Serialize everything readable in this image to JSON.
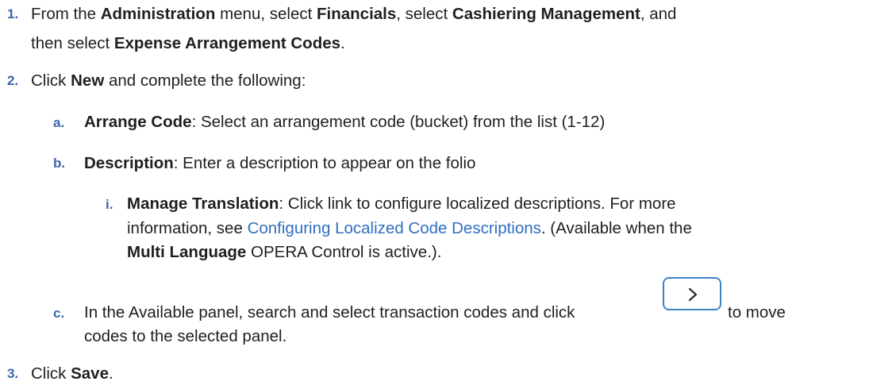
{
  "steps": [
    {
      "num": "1.",
      "line1": {
        "t1": "From the ",
        "b1": "Administration",
        "t2": " menu, select ",
        "b2": "Financials",
        "t3": ", select ",
        "b3": "Cashiering Management",
        "t4": ", and"
      },
      "line2": {
        "t1": "then select ",
        "b1": "Expense Arrangement Codes",
        "t2": "."
      }
    },
    {
      "num": "2.",
      "line1": {
        "t1": "Click ",
        "b1": "New",
        "t2": " and complete the following:"
      }
    },
    {
      "num": "3.",
      "line1": {
        "t1": "Click ",
        "b1": "Save",
        "t2": "."
      }
    }
  ],
  "substeps": [
    {
      "num": "a.",
      "b1": "Arrange Code",
      "t1": ": Select an arrangement code (bucket) from the list (1-12)"
    },
    {
      "num": "b.",
      "b1": "Description",
      "t1": ": Enter a description to appear on the folio"
    },
    {
      "num": "c.",
      "t1": "In the Available panel, search and select transaction codes and click",
      "t2": "to move",
      "line2": "codes to the selected panel."
    }
  ],
  "subsub": {
    "num": "i.",
    "line1": {
      "b1": "Manage Translation",
      "t1": ": Click link to configure localized descriptions. For more"
    },
    "line2": {
      "t1": "information, see ",
      "link": "Configuring Localized Code Descriptions",
      "t2": ". (Available when the"
    },
    "line3": {
      "b1": "Multi Language",
      "t1": " OPERA Control is active.)."
    }
  },
  "move_button": {
    "icon": "chevron-right-icon",
    "border_color": "#3b84c4"
  },
  "colors": {
    "number": "#3a67a8",
    "link": "#2f6fc0",
    "text": "#1f1f1f"
  }
}
